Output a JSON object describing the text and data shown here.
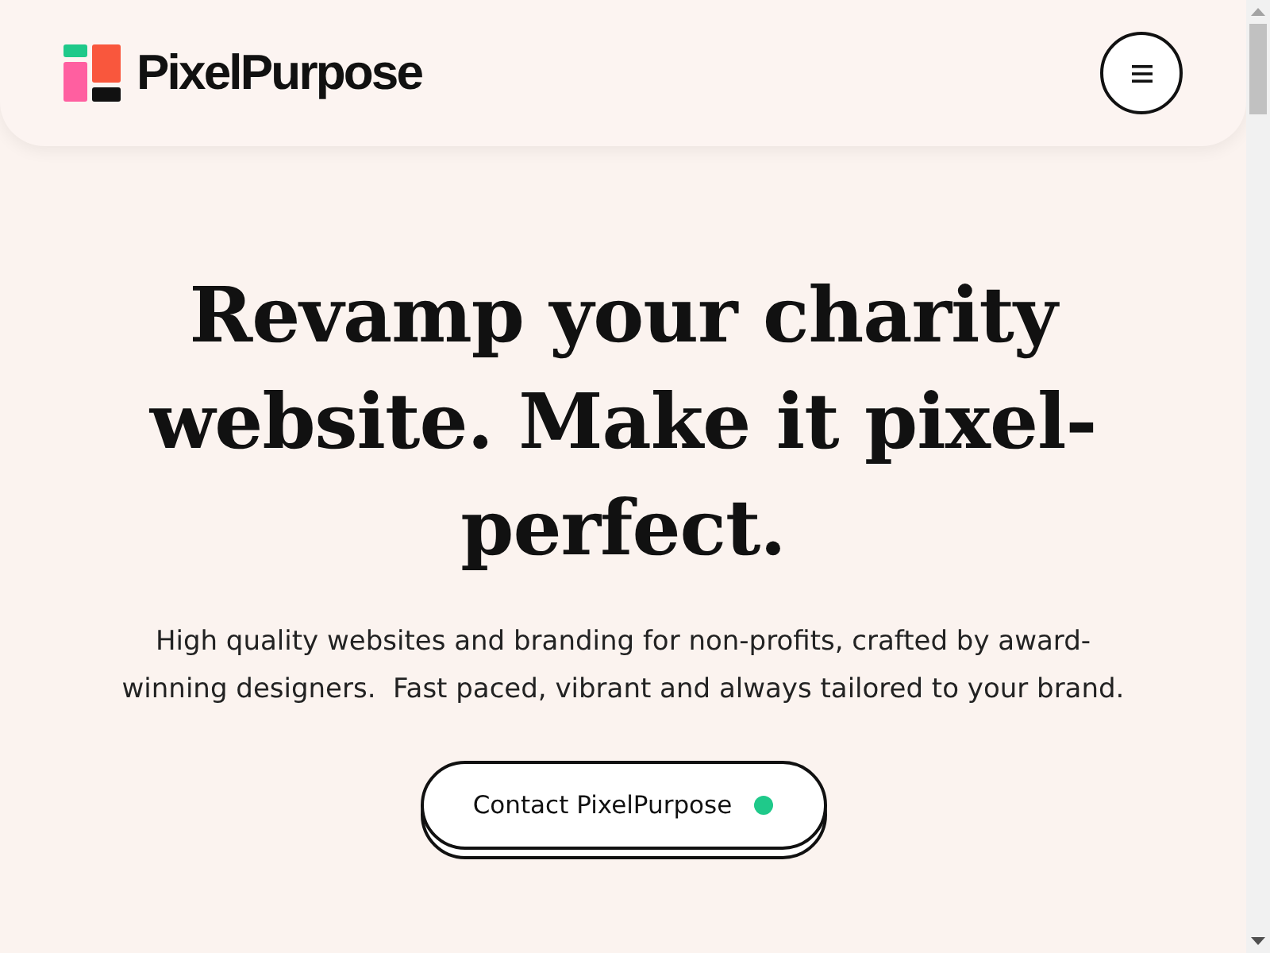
{
  "header": {
    "logo_text": "PixelPurpose"
  },
  "hero": {
    "heading": "Revamp your charity website. Make it pixel-perfect.",
    "description": "High quality websites and branding for non-profits, crafted by award-winning designers.  Fast paced, vibrant and always tailored to your brand.",
    "cta": {
      "label": "Contact PixelPurpose"
    }
  }
}
